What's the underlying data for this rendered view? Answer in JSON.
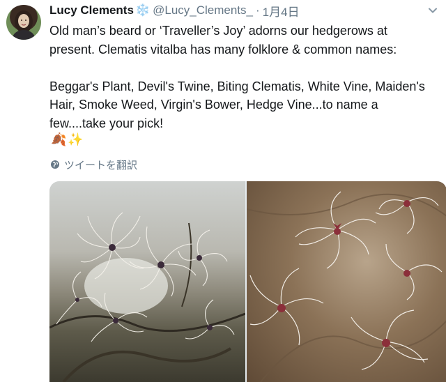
{
  "tweet": {
    "display_name": "Lucy Clements",
    "name_emoji": "❄️",
    "handle": "@Lucy_Clements_",
    "separator": "·",
    "date": "1月4日",
    "text": "Old man’s beard or ‘Traveller’s Joy’ adorns our hedgerows at\npresent. Clematis vitalba has many folklore & common names:\n\nBeggar's Plant, Devil's Twine, Biting Clematis, White Vine, Maiden's\nHair, Smoke Weed, Virgin's Bower, Hedge Vine...to name a\nfew....take your pick!",
    "emojis": [
      "🍂",
      "✨"
    ],
    "translate_label": "ツイートを翻訳"
  },
  "icons": {
    "snow": "snowflake-icon",
    "caret": "chevron-down-icon",
    "globe": "globe-icon",
    "leaf": "fallen-leaf-icon",
    "sparkles": "sparkles-icon"
  },
  "colors": {
    "text": "#14171a",
    "muted": "#657786",
    "snow": "#5aa5e6"
  }
}
